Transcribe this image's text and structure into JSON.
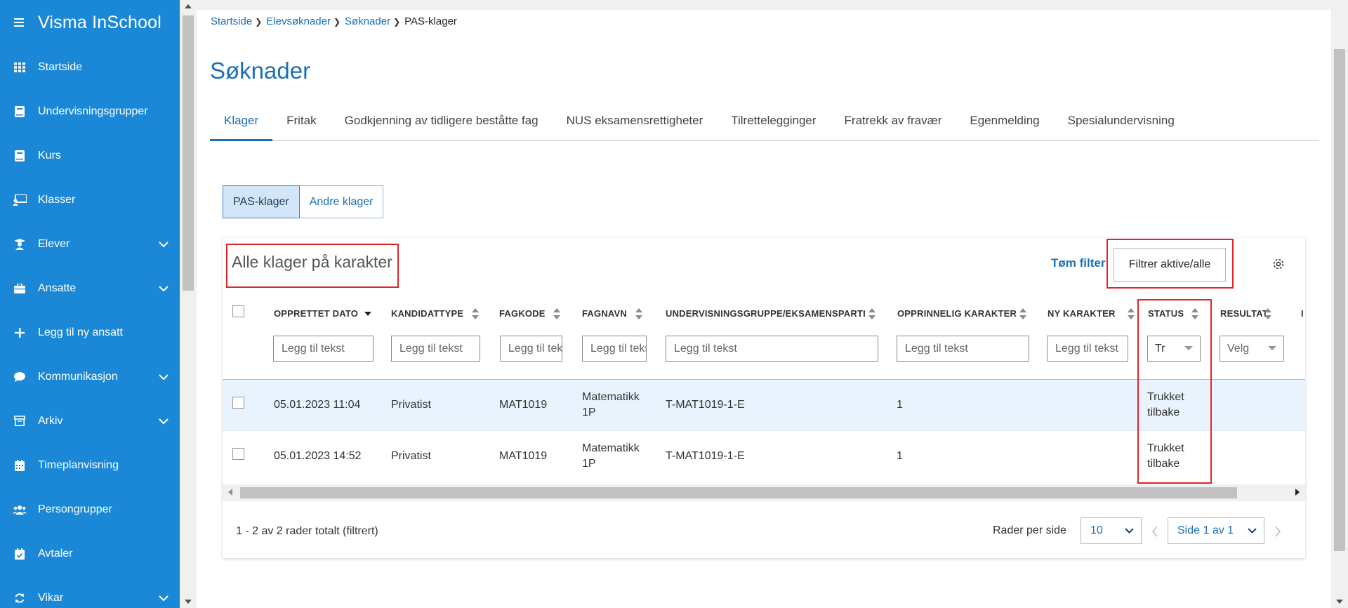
{
  "app": {
    "title": "Visma InSchool"
  },
  "sidebar": {
    "items": [
      {
        "label": "Startside",
        "icon": "grid-icon",
        "expandable": false
      },
      {
        "label": "Undervisningsgrupper",
        "icon": "book-icon",
        "expandable": false
      },
      {
        "label": "Kurs",
        "icon": "book-icon",
        "expandable": false
      },
      {
        "label": "Klasser",
        "icon": "classroom-icon",
        "expandable": false
      },
      {
        "label": "Elever",
        "icon": "student-icon",
        "expandable": true
      },
      {
        "label": "Ansatte",
        "icon": "briefcase-icon",
        "expandable": true
      },
      {
        "label": "Legg til ny ansatt",
        "icon": "plus-icon",
        "expandable": false
      },
      {
        "label": "Kommunikasjon",
        "icon": "chat-icon",
        "expandable": true
      },
      {
        "label": "Arkiv",
        "icon": "archive-icon",
        "expandable": true
      },
      {
        "label": "Timeplanvisning",
        "icon": "calendar-icon",
        "expandable": false
      },
      {
        "label": "Persongrupper",
        "icon": "people-icon",
        "expandable": false
      },
      {
        "label": "Avtaler",
        "icon": "calendar-check-icon",
        "expandable": false
      },
      {
        "label": "Vikar",
        "icon": "refresh-icon",
        "expandable": true
      }
    ]
  },
  "breadcrumb": [
    "Startside",
    "Elevsøknader",
    "Søknader",
    "PAS-klager"
  ],
  "page": {
    "title": "Søknader"
  },
  "tabs": [
    "Klager",
    "Fritak",
    "Godkjenning av tidligere beståtte fag",
    "NUS eksamensrettigheter",
    "Tilrettelegginger",
    "Fratrekk av fravær",
    "Egenmelding",
    "Spesialundervisning"
  ],
  "subtabs": [
    "PAS-klager",
    "Andre klager"
  ],
  "card": {
    "title": "Alle klager på karakter",
    "clear_filter": "Tøm filter",
    "filter_button": "Filtrer aktive/alle"
  },
  "table": {
    "columns": [
      "OPPRETTET DATO",
      "KANDIDATTYPE",
      "FAGKODE",
      "FAGNAVN",
      "UNDERVISNINGSGRUPPE/EKSAMENSPARTI",
      "OPPRINNELIG KARAKTER",
      "NY KARAKTER",
      "STATUS",
      "RESULTAT"
    ],
    "filter_placeholder": "Legg til tekst",
    "status_filter_value": "Tr",
    "result_filter_value": "Velg",
    "rows": [
      {
        "date": "05.01.2023 11:04",
        "type": "Privatist",
        "code": "MAT1019",
        "subject_l1": "Matematikk",
        "subject_l2": "1P",
        "group": "T-MAT1019-1-E",
        "orig": "1",
        "new": "",
        "status_l1": "Trukket",
        "status_l2": "tilbake",
        "result": ""
      },
      {
        "date": "05.01.2023 14:52",
        "type": "Privatist",
        "code": "MAT1019",
        "subject_l1": "Matematikk",
        "subject_l2": "1P",
        "group": "T-MAT1019-1-E",
        "orig": "1",
        "new": "",
        "status_l1": "Trukket",
        "status_l2": "tilbake",
        "result": ""
      }
    ]
  },
  "footer": {
    "count": "1 - 2 av 2 rader totalt (filtrert)",
    "rows_per_page_label": "Rader per side",
    "rows_per_page": "10",
    "page": "Side 1 av 1"
  },
  "colors": {
    "sidebar": "#1a88d6",
    "accent": "#1b6fb6",
    "highlight_row": "#e8f3fd",
    "annotation_red": "#e0262a"
  }
}
